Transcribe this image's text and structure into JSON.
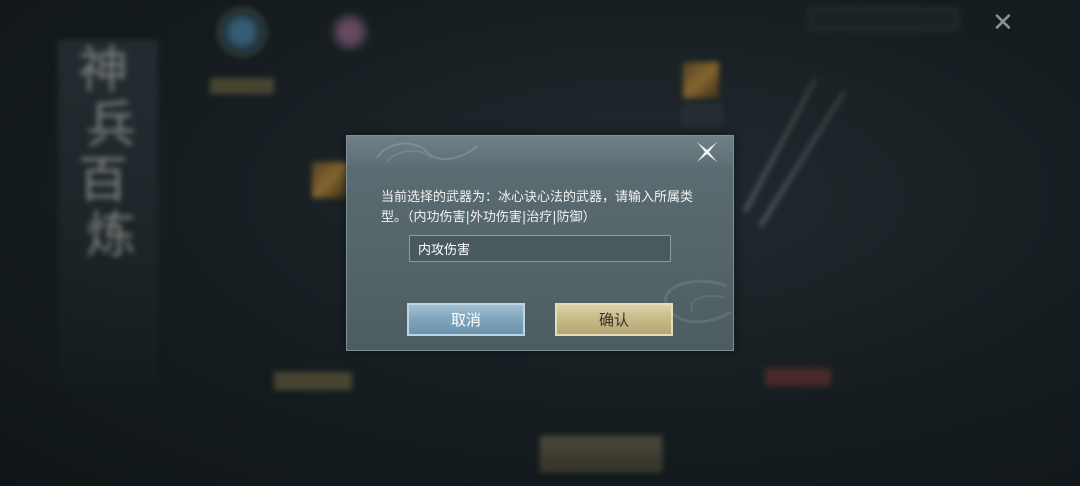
{
  "background": {
    "title_chars": [
      "神",
      "兵",
      "百",
      "炼"
    ],
    "colors": {
      "bg": "#1d2529",
      "gold": "#c9b985"
    }
  },
  "dialog": {
    "prompt": "当前选择的武器为：冰心诀心法的武器，请输入所属类型。（内功伤害|外功伤害|治疗|防御）",
    "input_value": "内攻伤害",
    "cancel_label": "取消",
    "confirm_label": "确认",
    "close_icon": "close-x-icon",
    "colors": {
      "panel": "#5d6e74",
      "cancel": "#7ea3bb",
      "confirm": "#c7b888"
    }
  }
}
